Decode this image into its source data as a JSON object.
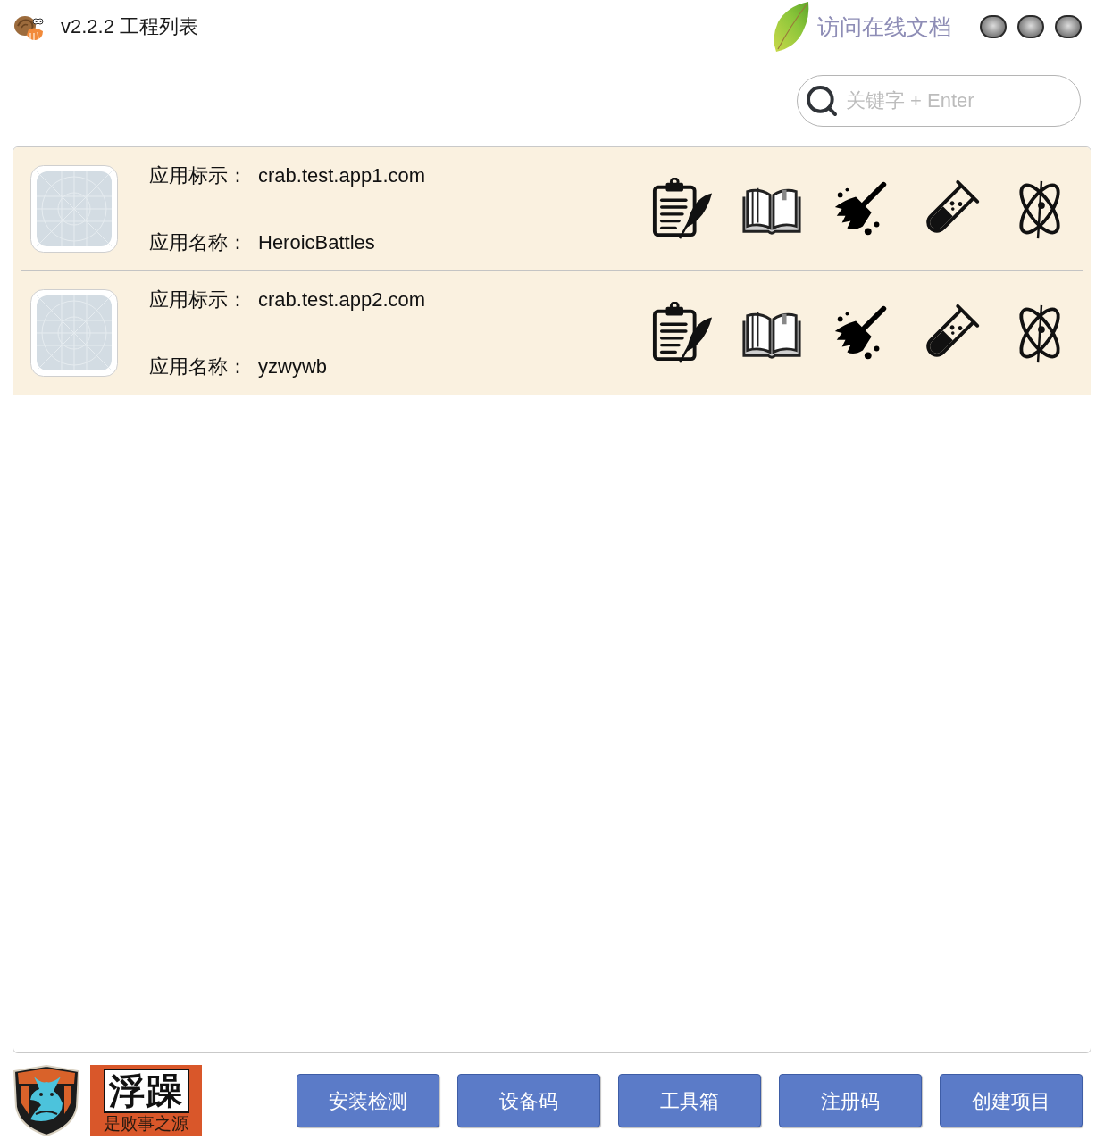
{
  "title_bar": {
    "title": "v2.2.2 工程列表",
    "docs_link": "访问在线文档"
  },
  "search": {
    "placeholder": "关键字 + Enter"
  },
  "projects": [
    {
      "id_label": "应用标示：",
      "bundle_id": "crab.test.app1.com",
      "name_label": "应用名称：",
      "app_name": "HeroicBattles"
    },
    {
      "id_label": "应用标示：",
      "bundle_id": "crab.test.app2.com",
      "name_label": "应用名称：",
      "app_name": "yzwywb"
    }
  ],
  "footer": {
    "badge": {
      "title": "浮躁",
      "motto": "是败事之源"
    },
    "buttons": [
      "安装检测",
      "设备码",
      "工具箱",
      "注册码",
      "创建项目"
    ]
  }
}
